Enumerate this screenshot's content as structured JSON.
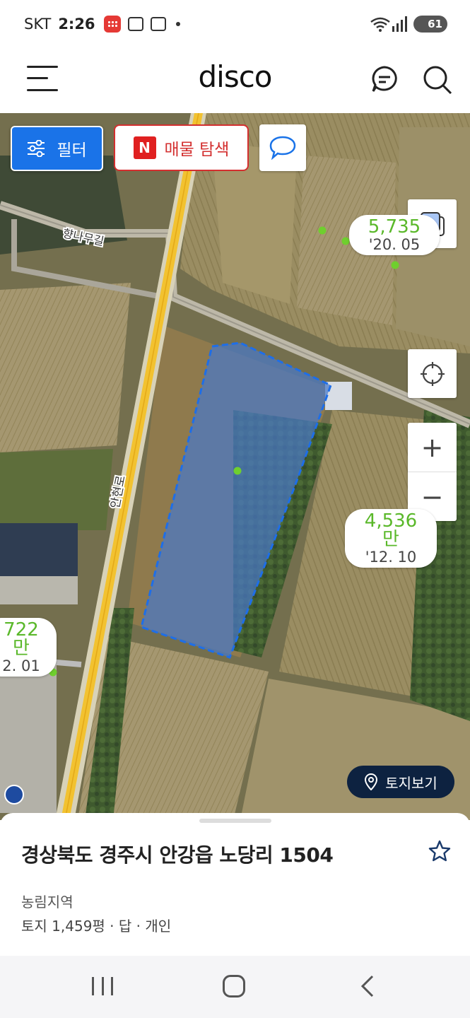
{
  "status_bar": {
    "carrier": "SKT",
    "time": "2:26",
    "battery": "61"
  },
  "app_bar": {
    "logo": "disco",
    "menu_icon": "hamburger-menu-icon",
    "chat_icon": "chat-bubble-icon",
    "search_icon": "search-icon"
  },
  "map": {
    "filter_label": "필터",
    "listing_badge": "N",
    "listing_label": "매물 탐색",
    "road_label_1": "향나무길",
    "road_label_2": "안현로",
    "price_tags": [
      {
        "price": "5,735",
        "date": "'20. 05"
      },
      {
        "price": "4,536만",
        "date": "'12. 10"
      },
      {
        "price": "722만",
        "date": "2. 01"
      }
    ],
    "zoom_in": "+",
    "zoom_out": "−",
    "land_view_label": "토지보기",
    "colors": {
      "parcel_fill": "#4a78c8",
      "parcel_border": "#1e6ee8",
      "price": "#5ab82a",
      "primary": "#1a73e8"
    }
  },
  "sheet": {
    "address": "경상북도 경주시 안강읍 노당리 1504",
    "zone": "농림지역",
    "land_info": "토지 1,459평 · 답 · 개인"
  }
}
